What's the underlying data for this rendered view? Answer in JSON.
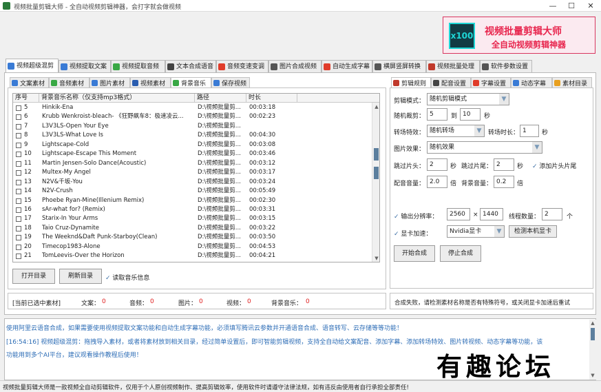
{
  "window": {
    "title": "视频批量剪辑大师 - 全自动视频剪辑神器，会打字就会做视频",
    "minimize": "—",
    "maximize": "☐",
    "close": "✕"
  },
  "banner": {
    "logo_text": "x100",
    "line1": "视频批量剪辑大师",
    "line2": "全自动视频剪辑神器"
  },
  "main_tabs": [
    {
      "label": "视频超级混剪",
      "color": "#3a7bd5",
      "active": true
    },
    {
      "label": "视频提取文案",
      "color": "#3a7bd5"
    },
    {
      "label": "视频提取音频",
      "color": "#39a845"
    },
    {
      "label": "文本合成语音",
      "color": "#444444"
    },
    {
      "label": "音频变速变调",
      "color": "#e03c2a"
    },
    {
      "label": "图片合成视频",
      "color": "#555555"
    },
    {
      "label": "自动生成字幕",
      "color": "#e03c2a"
    },
    {
      "label": "横屏竖屏转换",
      "color": "#555555"
    },
    {
      "label": "视频批量处理",
      "color": "#c0392b"
    },
    {
      "label": "软件参数设置",
      "color": "#555555"
    }
  ],
  "sub_tabs": [
    {
      "label": "文案素材",
      "color": "#3a7bd5"
    },
    {
      "label": "音频素材",
      "color": "#39a845"
    },
    {
      "label": "图片素材",
      "color": "#3a7bd5"
    },
    {
      "label": "视频素材",
      "color": "#2a5db0"
    },
    {
      "label": "背景音乐",
      "color": "#39a845",
      "active": true
    },
    {
      "label": "保存视频",
      "color": "#3a7bd5"
    }
  ],
  "table": {
    "headers": [
      "序号",
      "背景音乐名称（仅支持mp3格式）",
      "路径",
      "时长"
    ],
    "rows": [
      {
        "no": "5",
        "name": "Hinkik-Ena",
        "path": "D:\\视频批量剪...",
        "duration": "00:03:18"
      },
      {
        "no": "6",
        "name": "Krubb Wenkroist-bleach- 《狂野飙车8：极速凌云...",
        "path": "D:\\视频批量剪...",
        "duration": "00:02:23"
      },
      {
        "no": "7",
        "name": "L3V3LS-Open Your Eye",
        "path": "D:\\视频批量剪...",
        "duration": ""
      },
      {
        "no": "8",
        "name": "L3V3LS-What Love Is",
        "path": "D:\\视频批量剪...",
        "duration": "00:04:30"
      },
      {
        "no": "9",
        "name": "Lightscape-Cold",
        "path": "D:\\视频批量剪...",
        "duration": "00:03:08"
      },
      {
        "no": "10",
        "name": "Lightscape-Escape This Moment",
        "path": "D:\\视频批量剪...",
        "duration": "00:03:46"
      },
      {
        "no": "11",
        "name": "Martin Jensen-Solo Dance(Acoustic)",
        "path": "D:\\视频批量剪...",
        "duration": "00:03:12"
      },
      {
        "no": "12",
        "name": "Multex-My Angel",
        "path": "D:\\视频批量剪...",
        "duration": "00:03:17"
      },
      {
        "no": "13",
        "name": "N2V&千坂-You",
        "path": "D:\\视频批量剪...",
        "duration": "00:03:24"
      },
      {
        "no": "14",
        "name": "N2V-Crush",
        "path": "D:\\视频批量剪...",
        "duration": "00:05:49"
      },
      {
        "no": "15",
        "name": "Phoebe Ryan-Mine(Illenium Remix)",
        "path": "D:\\视频批量剪...",
        "duration": "00:02:30"
      },
      {
        "no": "16",
        "name": "sAr-what for? (Remix)",
        "path": "D:\\视频批量剪...",
        "duration": "00:03:31"
      },
      {
        "no": "17",
        "name": "Starix-In Your Arms",
        "path": "D:\\视频批量剪...",
        "duration": "00:03:15"
      },
      {
        "no": "18",
        "name": "Taio Cruz-Dynamite",
        "path": "D:\\视频批量剪...",
        "duration": "00:03:22"
      },
      {
        "no": "19",
        "name": "The Weeknd&Daft Punk-Starboy(Clean)",
        "path": "D:\\视频批量剪...",
        "duration": "00:03:50"
      },
      {
        "no": "20",
        "name": "Timecop1983-Alone",
        "path": "D:\\视频批量剪...",
        "duration": "00:04:53"
      },
      {
        "no": "21",
        "name": "TomLeevis-Over the Horizon",
        "path": "D:\\视频批量剪...",
        "duration": "00:04:21"
      }
    ]
  },
  "left_buttons": {
    "open_dir": "打开目录",
    "refresh_dir": "刷新目录",
    "read_info": "读取音乐信息"
  },
  "selected_counts": {
    "label": "[当前已选中素材]",
    "text_label": "文案：",
    "text_value": "0",
    "audio_label": "音频：",
    "audio_value": "0",
    "image_label": "图片：",
    "image_value": "0",
    "video_label": "视频：",
    "video_value": "0",
    "bgm_label": "背景音乐：",
    "bgm_value": "0"
  },
  "right_tabs": [
    {
      "label": "剪辑规则",
      "color": "#c0392b",
      "active": true
    },
    {
      "label": "配音设置",
      "color": "#444444"
    },
    {
      "label": "字幕设置",
      "color": "#e03c2a"
    },
    {
      "label": "动态字幕",
      "color": "#3a7bd5"
    },
    {
      "label": "素材目录",
      "color": "#e8a020"
    }
  ],
  "settings": {
    "edit_mode_label": "剪辑模式：",
    "edit_mode_value": "随机剪辑模式",
    "random_cut_label": "随机裁剪：",
    "random_cut_from": "5",
    "random_cut_to_label": "到",
    "random_cut_to": "10",
    "sec": "秒",
    "transition_label": "转场特效：",
    "transition_value": "随机转场",
    "transition_time_label": "转场时长：",
    "transition_time_value": "1",
    "image_effect_label": "图片效果：",
    "image_effect_value": "随机效果",
    "skip_head_label": "跳过片头：",
    "skip_head_value": "2",
    "skip_tail_label": "跳过片尾：",
    "skip_tail_value": "2",
    "add_head_tail_label": "添加片头片尾",
    "dub_volume_label": "配音音量：",
    "dub_volume_value": "2.0",
    "bgm_volume_label": "背景音量：",
    "bgm_volume_value": "0.2",
    "times": "倍",
    "resolution_label": "输出分辨率：",
    "res_w": "2560",
    "res_x": "×",
    "res_h": "1440",
    "threads_label": "线程数量：",
    "threads_value": "2",
    "threads_unit": "个",
    "gpu_label": "显卡加速：",
    "gpu_value": "Nvidia显卡",
    "detect_gpu_btn": "检测本机显卡",
    "start_btn": "开始合成",
    "stop_btn": "停止合成"
  },
  "right_status": "合成失败，请检测素材名称是否有特殊符号，或关闭显卡加速后重试",
  "log": {
    "line1": "使用阿里云语音合成，如果需要使用视频提取文案功能和自动生成字幕功能，必须填写腾讯云参数并开通语音合成、语音转写、云存储等等功能！",
    "line2": "[16:54:16] 视频超级混剪：拖拽导入素材，或者将素材放到相关目录，经过简单设置后，即可智能剪辑视频，支持全自动给文案配音、添加字幕、添加转场特效、图片转视频、动态字幕等功能，该",
    "line3": "功能用到多个AI平台，建议观看操作教程后使用！"
  },
  "statusbar": "视频批量剪辑大师是一款视频全自动剪辑软件，仅用于个人原创视频制作、提高剪辑效率，使用软件时请遵守法律法规，如有违反由使用者自行承担全部责任!",
  "watermark": "有趣论坛",
  "colors": {
    "accent_red": "#e8264e",
    "log_blue": "#2d6db6",
    "count_red": "#e02020"
  }
}
